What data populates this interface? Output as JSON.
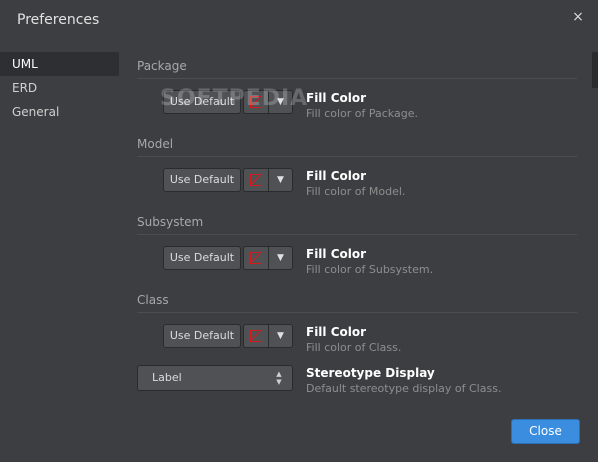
{
  "dialog": {
    "title": "Preferences",
    "close_icon": "×"
  },
  "sidebar": {
    "items": [
      {
        "label": "UML"
      },
      {
        "label": "ERD"
      },
      {
        "label": "General"
      }
    ]
  },
  "sections": [
    {
      "title": "Package",
      "use_default": "Use Default",
      "label": "Fill Color",
      "desc": "Fill color of Package."
    },
    {
      "title": "Model",
      "use_default": "Use Default",
      "label": "Fill Color",
      "desc": "Fill color of Model."
    },
    {
      "title": "Subsystem",
      "use_default": "Use Default",
      "label": "Fill Color",
      "desc": "Fill color of Subsystem."
    },
    {
      "title": "Class",
      "use_default": "Use Default",
      "label": "Fill Color",
      "desc": "Fill color of Class."
    }
  ],
  "stereotype": {
    "value": "Label",
    "label": "Stereotype Display",
    "desc": "Default stereotype display of Class."
  },
  "footer": {
    "close_label": "Close"
  },
  "watermark": "SOFTPEDIA",
  "colors": {
    "accent": "#3b8de0",
    "swatch": "#d21b1b"
  }
}
